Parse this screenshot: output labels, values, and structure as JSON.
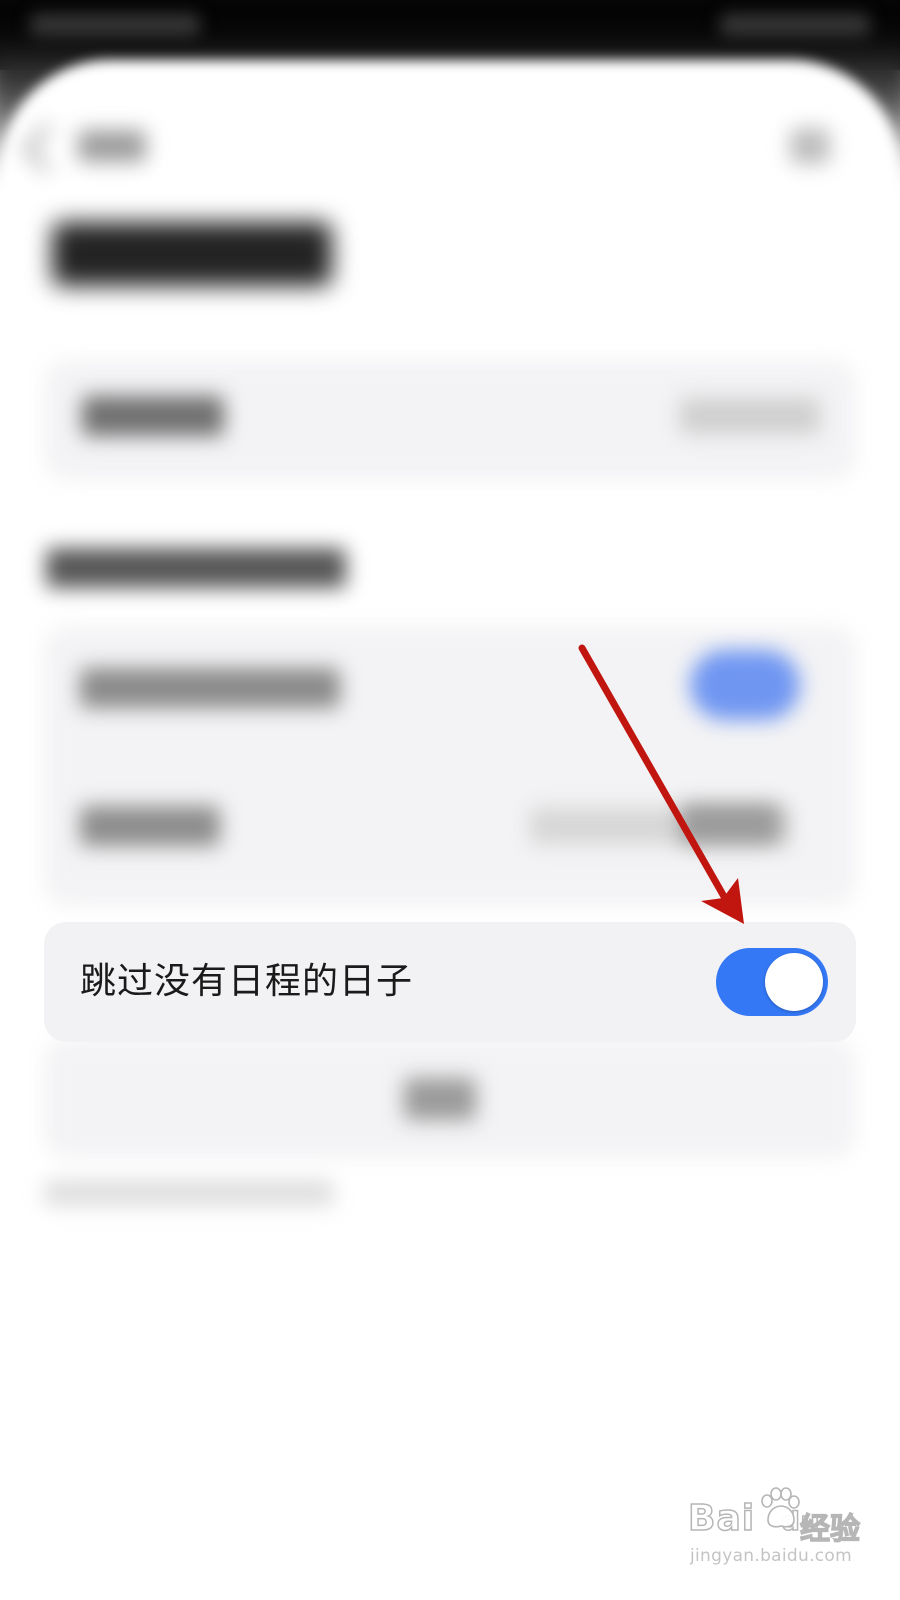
{
  "settings": {
    "skip_empty_days": {
      "label": "跳过没有日程的日子",
      "enabled": true,
      "toggle_color": "#3478f6"
    }
  },
  "annotation": {
    "type": "arrow",
    "color": "#c0160f",
    "points_to": "skip-empty-days-toggle"
  },
  "watermark": {
    "logo_text": "Bai",
    "logo_suffix": "du",
    "brand_cn": "经验",
    "url": "jingyan.baidu.com"
  },
  "icons": {
    "back": "chevron-left-icon",
    "watermark_paw": "paw-icon"
  }
}
